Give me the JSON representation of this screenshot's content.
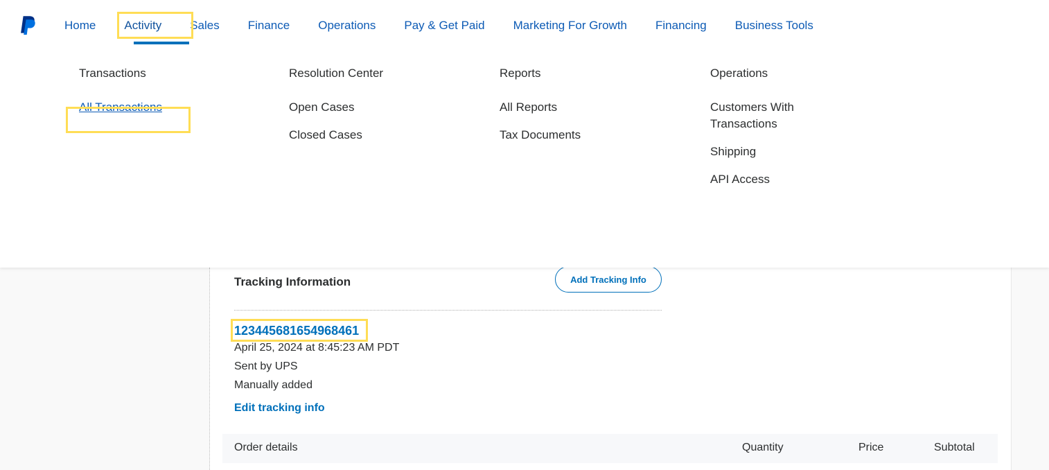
{
  "brand": {
    "logo_icon": "paypal-logo-icon",
    "logo_dark_color": "#003087",
    "logo_light_color": "#0070e0"
  },
  "topnav": {
    "items": [
      {
        "label": "Home",
        "active": false
      },
      {
        "label": "Activity",
        "active": true
      },
      {
        "label": "Sales",
        "active": false
      },
      {
        "label": "Finance",
        "active": false
      },
      {
        "label": "Operations",
        "active": false
      },
      {
        "label": "Pay & Get Paid",
        "active": false
      },
      {
        "label": "Marketing For Growth",
        "active": false
      },
      {
        "label": "Financing",
        "active": false
      },
      {
        "label": "Business Tools",
        "active": false
      }
    ],
    "active_underline_color": "#0070ba",
    "link_color": "#0d5bb5"
  },
  "megamenu": {
    "columns": [
      {
        "heading": "Transactions",
        "links": [
          {
            "label": "All Transactions",
            "highlighted": true
          }
        ]
      },
      {
        "heading": "Resolution Center",
        "links": [
          {
            "label": "Open Cases",
            "highlighted": false
          },
          {
            "label": "Closed Cases",
            "highlighted": false
          }
        ]
      },
      {
        "heading": "Reports",
        "links": [
          {
            "label": "All Reports",
            "highlighted": false
          },
          {
            "label": "Tax Documents",
            "highlighted": false
          }
        ]
      },
      {
        "heading": "Operations",
        "links": [
          {
            "label": "Customers With Transactions",
            "highlighted": false
          },
          {
            "label": "Shipping",
            "highlighted": false
          },
          {
            "label": "API Access",
            "highlighted": false
          }
        ]
      }
    ]
  },
  "tracking": {
    "title": "Tracking Information",
    "add_button_label": "Add Tracking Info",
    "number": "123445681654968461",
    "date": "April 25, 2024 at 8:45:23 AM PDT",
    "carrier": "Sent by UPS",
    "source": "Manually added",
    "edit_link": "Edit tracking info"
  },
  "order_table": {
    "headers": {
      "details": "Order details",
      "quantity": "Quantity",
      "price": "Price",
      "subtotal": "Subtotal"
    }
  },
  "annotations": {
    "highlight_color": "#ffdd55",
    "boxes": [
      "activity-tab",
      "all-transactions-link",
      "tracking-number"
    ]
  }
}
